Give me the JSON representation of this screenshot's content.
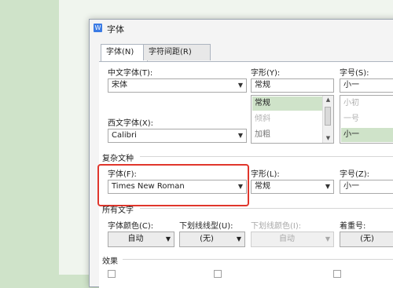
{
  "dialog": {
    "title": "字体"
  },
  "tabs": [
    {
      "label": "字体(N)",
      "active": true
    },
    {
      "label": "字符间距(R)",
      "active": false
    }
  ],
  "chinese_font": {
    "label": "中文字体(T):",
    "value": "宋体"
  },
  "style": {
    "label": "字形(Y):",
    "value": "常规",
    "options": [
      "常规",
      "倾斜",
      "加粗"
    ],
    "selected": "常规"
  },
  "size": {
    "label": "字号(S):",
    "value": "小一",
    "options": [
      "小初",
      "一号",
      "小一"
    ],
    "selected": "小一"
  },
  "western_font": {
    "label": "西文字体(X):",
    "value": "Calibri"
  },
  "complex": {
    "group_label": "复杂文种",
    "font_label": "字体(F):",
    "font_value": "Times New Roman",
    "style_label": "字形(L):",
    "style_value": "常规",
    "size_label": "字号(Z):",
    "size_value": "小一"
  },
  "all_text": {
    "group_label": "所有文字",
    "color_label": "字体颜色(C):",
    "color_value": "自动",
    "underline_label": "下划线线型(U):",
    "underline_value": "(无)",
    "underline_color_label": "下划线颜色(I):",
    "underline_color_value": "自动",
    "emphasis_label": "着重号:",
    "emphasis_value": "(无)"
  },
  "effects": {
    "group_label": "效果"
  },
  "colors": {
    "highlight": "#e0362c",
    "selection": "#cfe3c9",
    "accent": "#3b7be4"
  }
}
